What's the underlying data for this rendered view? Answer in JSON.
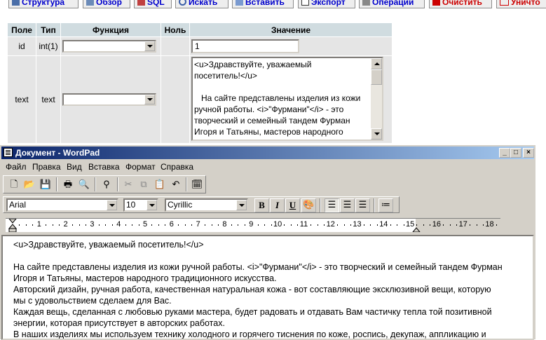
{
  "pma": {
    "tabs": [
      {
        "label": "Структура",
        "icon": "structure-icon",
        "color": "#0000cc"
      },
      {
        "label": "Обзор",
        "icon": "browse-icon",
        "color": "#0000cc"
      },
      {
        "label": "SQL",
        "icon": "sql-icon",
        "color": "#0000cc"
      },
      {
        "label": "Искать",
        "icon": "search-icon",
        "color": "#0000cc"
      },
      {
        "label": "Вставить",
        "icon": "insert-icon",
        "color": "#0000cc"
      },
      {
        "label": "Экспорт",
        "icon": "export-icon",
        "color": "#0000cc"
      },
      {
        "label": "Операции",
        "icon": "operations-icon",
        "color": "#0000cc"
      },
      {
        "label": "Очистить",
        "icon": "empty-icon",
        "color": "#cc0000"
      },
      {
        "label": "Уничто",
        "icon": "drop-icon",
        "color": "#cc0000"
      }
    ],
    "columns": [
      "Поле",
      "Тип",
      "Функция",
      "Ноль",
      "Значение"
    ],
    "rows": [
      {
        "field": "id",
        "type": "int(1)",
        "value": "1"
      },
      {
        "field": "text",
        "type": "text",
        "value": "<u>Здравствуйте, уважаемый\nпосетитель!</u>\n\n   На сайте представлены изделия из кожи\nручной работы. <i>\"Фурмани\"</i> - это\nтворческий и семейный тандем Фурман\nИгоря и Татьяны, мастеров народного\nтрадиционного искусства."
      }
    ]
  },
  "wordpad": {
    "title": "Документ - WordPad",
    "menu": [
      "Файл",
      "Правка",
      "Вид",
      "Вставка",
      "Формат",
      "Справка"
    ],
    "font_name": "Arial",
    "font_size": "10",
    "script": "Cyrillic",
    "format_buttons": {
      "bold": "B",
      "italic": "I",
      "underline": "U"
    },
    "ruler_numbers": [
      "1",
      "2",
      "3",
      "4",
      "5",
      "6",
      "7",
      "8",
      "9",
      "10",
      "11",
      "12",
      "13",
      "14",
      "15",
      "16",
      "17",
      "18"
    ],
    "document_lines": [
      "<u>Здравствуйте, уважаемый посетитель!</u>",
      "",
      "   На сайте представлены изделия из кожи ручной работы. <i>\"Фурмани\"</i> - это творческий и семейный тандем Фурман",
      "Игоря и Татьяны, мастеров народного традиционного искусства.",
      "   Авторский дизайн, ручная работа, качественная натуральная кожа - вот составляющие эксклюзивной вещи, которую",
      "мы с удовольствием сделаем для Вас.",
      "   Каждая вещь, сделанная с любовью руками мастера, будет радовать и отдавать Вам частичку тепла той позитивной",
      "энергии, которая присутствует в авторских работах.",
      "   В наших изделиях мы используем технику холодного и горячего тиснения по коже, роспись, декупаж, аппликацию и"
    ]
  }
}
